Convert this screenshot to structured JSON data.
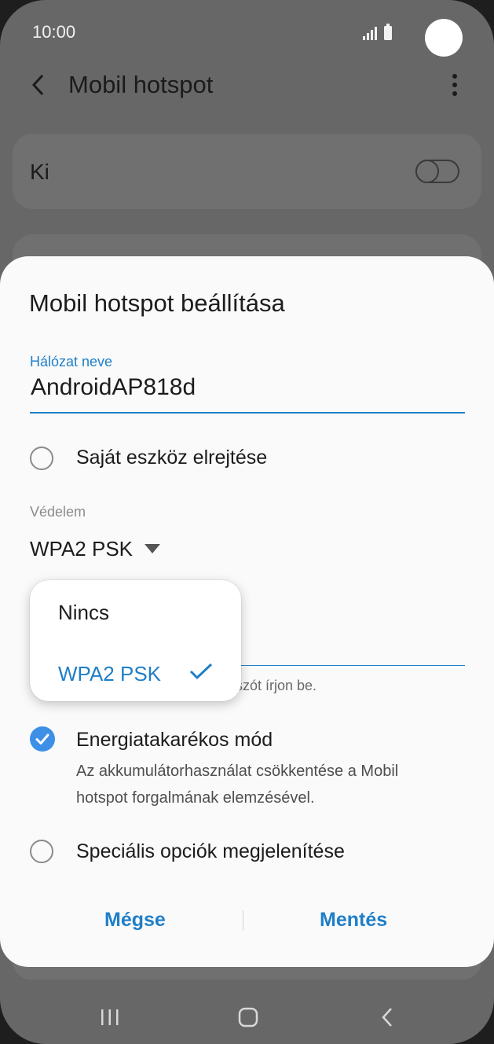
{
  "status_bar": {
    "time": "10:00"
  },
  "app_bar": {
    "title": "Mobil hotspot"
  },
  "hotspot_card": {
    "label": "Ki"
  },
  "dialog": {
    "title": "Mobil hotspot beállítása",
    "network_name": {
      "label": "Hálózat neve",
      "value": "AndroidAP818d"
    },
    "hide_device": {
      "label": "Saját eszköz elrejtése",
      "checked": false
    },
    "security": {
      "label": "Védelem",
      "value": "WPA2 PSK"
    },
    "password_hint": "elszót írjon be.",
    "power_saving": {
      "label": "Energiatakarékos mód",
      "description": "Az akkumulátorhasználat csökkentése a Mobil hotspot forgalmának elemzésével.",
      "checked": true
    },
    "advanced": {
      "label": "Speciális opciók megjelenítése",
      "checked": false
    },
    "buttons": {
      "cancel": "Mégse",
      "save": "Mentés"
    }
  },
  "security_dropdown": {
    "options": [
      {
        "label": "Nincs",
        "selected": false
      },
      {
        "label": "WPA2 PSK",
        "selected": true
      }
    ]
  },
  "colors": {
    "accent": "#1f7fc8",
    "check_fill": "#3e8fe6",
    "scrim": "#676767",
    "dialog_bg": "#fafafa"
  },
  "icons": {
    "back": "back-arrow-icon",
    "more": "more-vert-icon",
    "check": "checkmark-icon",
    "caret": "caret-down-icon",
    "nav_recents": "recents-icon",
    "nav_home": "home-icon",
    "nav_back": "nav-back-icon"
  }
}
